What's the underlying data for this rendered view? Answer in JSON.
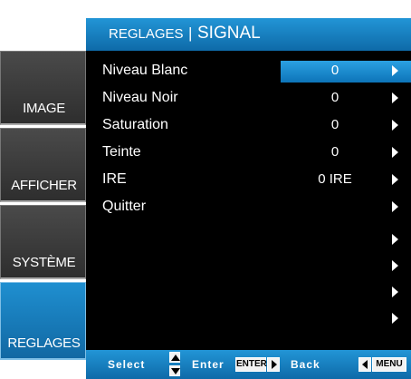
{
  "tabs": [
    {
      "label": "IMAGE",
      "active": false
    },
    {
      "label": "AFFICHER",
      "active": false
    },
    {
      "label": "SYSTÈME",
      "active": false
    },
    {
      "label": "REGLAGES",
      "active": true
    }
  ],
  "header": {
    "section": "REGLAGES",
    "separator": "|",
    "title": "SIGNAL"
  },
  "items": [
    {
      "label": "Niveau Blanc",
      "value": "0",
      "selected": true
    },
    {
      "label": "Niveau Noir",
      "value": "0"
    },
    {
      "label": "Saturation",
      "value": "0"
    },
    {
      "label": "Teinte",
      "value": "0"
    },
    {
      "label": "IRE",
      "value": "0 IRE"
    },
    {
      "label": "Quitter",
      "value": ""
    }
  ],
  "footer": {
    "select_label": "Select",
    "enter_label": "Enter",
    "enter_key": "ENTER",
    "back_label": "Back",
    "menu_key": "MENU"
  },
  "colors": {
    "accent": "#1a82c4",
    "panel_bg": "#000000",
    "tab_bg": "#3a3a3a"
  },
  "icons": {
    "row_arrow": "chevron-right-icon",
    "updown": "up-down-icon"
  }
}
